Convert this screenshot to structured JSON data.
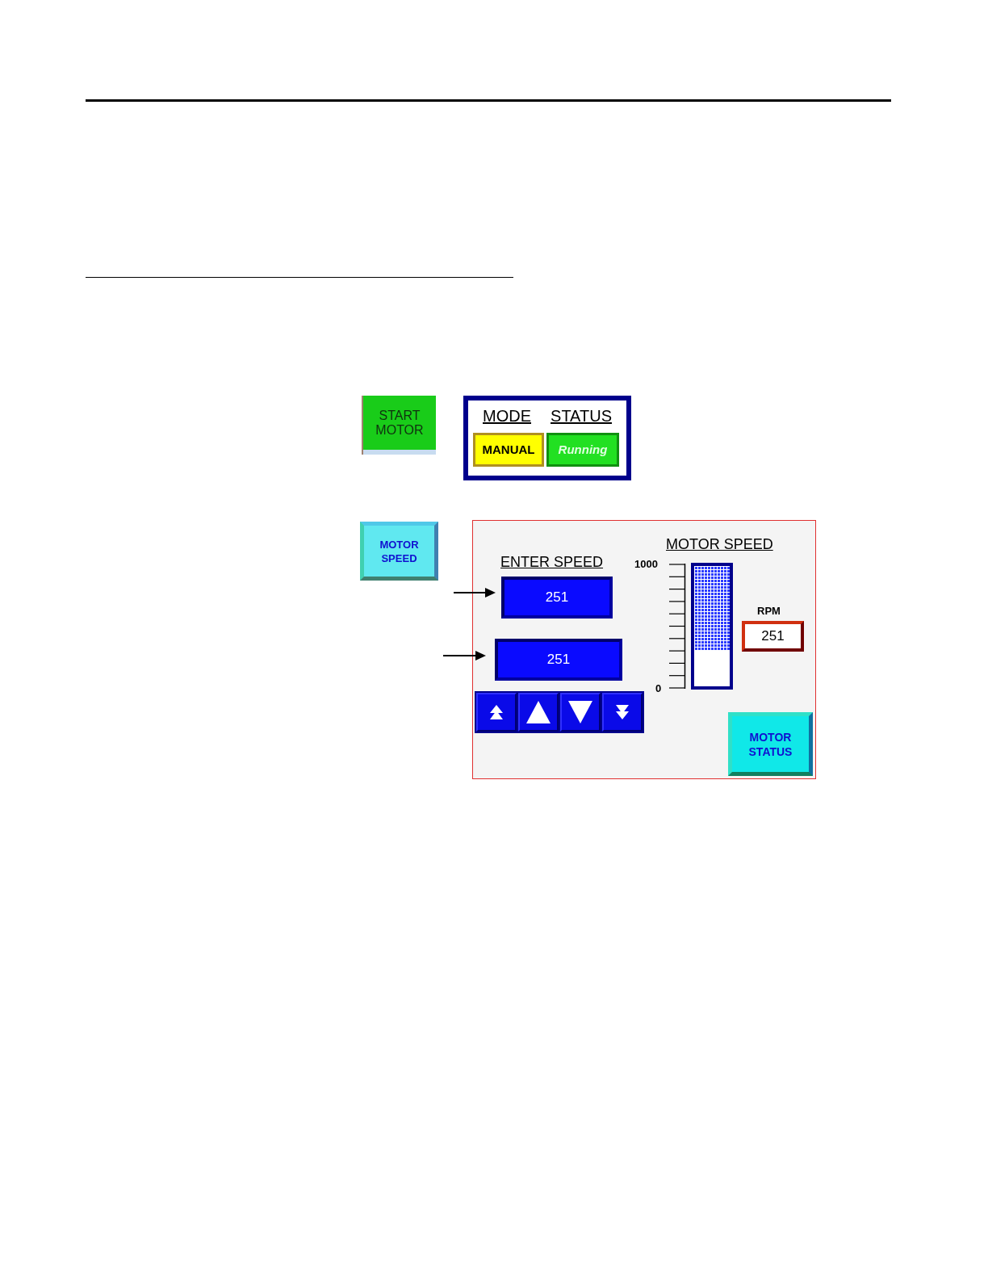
{
  "start_button": {
    "label": "START MOTOR"
  },
  "mode_status": {
    "mode_heading": "MODE",
    "status_heading": "STATUS",
    "mode": "MANUAL",
    "status": "Running"
  },
  "motor_speed_button": {
    "label": "MOTOR SPEED"
  },
  "panel": {
    "enter_speed_heading": "ENTER SPEED",
    "entries": [
      "251",
      "251"
    ],
    "step_buttons": [
      {
        "kind": "fast_up"
      },
      {
        "kind": "up"
      },
      {
        "kind": "down"
      },
      {
        "kind": "fast_down"
      }
    ],
    "gauge": {
      "title": "MOTOR SPEED",
      "max_label": "1000",
      "min_label": "0",
      "level": 0.3
    },
    "rpm_label": "RPM",
    "rpm_value": "251",
    "status_button": "MOTOR STATUS"
  }
}
